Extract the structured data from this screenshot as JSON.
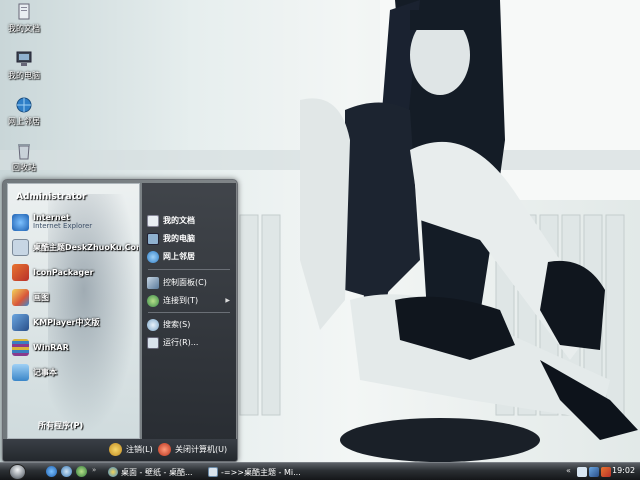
{
  "desktop": {
    "icons": [
      {
        "label": "我的文档",
        "icon": "documents-folder-icon"
      },
      {
        "label": "我的电脑",
        "icon": "computer-icon"
      },
      {
        "label": "网上邻居",
        "icon": "network-icon"
      },
      {
        "label": "回收站",
        "icon": "recycle-bin-icon"
      }
    ]
  },
  "start_menu": {
    "user": "Administrator",
    "programs": [
      {
        "title": "Internet",
        "subtitle": "Internet Explorer",
        "icon": "ie-icon",
        "color": "#2a7fd4"
      },
      {
        "title": "桌酷主题DeskZhuoKu.Com",
        "subtitle": "",
        "icon": "theme-icon",
        "color": "#c7d6e4"
      },
      {
        "title": "IconPackager",
        "subtitle": "",
        "icon": "iconpackager-icon",
        "color": "#d0532c"
      },
      {
        "title": "画图",
        "subtitle": "",
        "icon": "paint-icon",
        "color": "#e3b53a"
      },
      {
        "title": "KMPlayer中文版",
        "subtitle": "",
        "icon": "kmplayer-icon",
        "color": "#3b6fb0"
      },
      {
        "title": "WinRAR",
        "subtitle": "",
        "icon": "winrar-icon",
        "color": "#8a3a8c"
      },
      {
        "title": "记事本",
        "subtitle": "",
        "icon": "notepad-icon",
        "color": "#5aa0d8"
      }
    ],
    "all_programs": "所有程序(P)",
    "places_top": [
      {
        "label": "我的文档",
        "icon": "documents-icon"
      },
      {
        "label": "我的电脑",
        "icon": "computer-icon"
      },
      {
        "label": "网上邻居",
        "icon": "network-icon"
      }
    ],
    "places_bottom": [
      {
        "label": "控制面板(C)",
        "icon": "control-panel-icon"
      },
      {
        "label": "连接到(T)",
        "icon": "connect-icon",
        "submenu": true
      }
    ],
    "places_tools": [
      {
        "label": "搜索(S)",
        "icon": "search-icon"
      },
      {
        "label": "运行(R)...",
        "icon": "run-icon"
      }
    ],
    "logoff": "注销(L)",
    "shutdown": "关闭计算机(U)"
  },
  "taskbar": {
    "tasks": [
      {
        "label": "桌面 - 壁纸 - 桌酷...",
        "icon": "browser-icon"
      },
      {
        "label": "-=>>桌酷主题 - Mi...",
        "icon": "document-icon"
      }
    ],
    "clock": "19:02",
    "tray_arrow": "«"
  }
}
